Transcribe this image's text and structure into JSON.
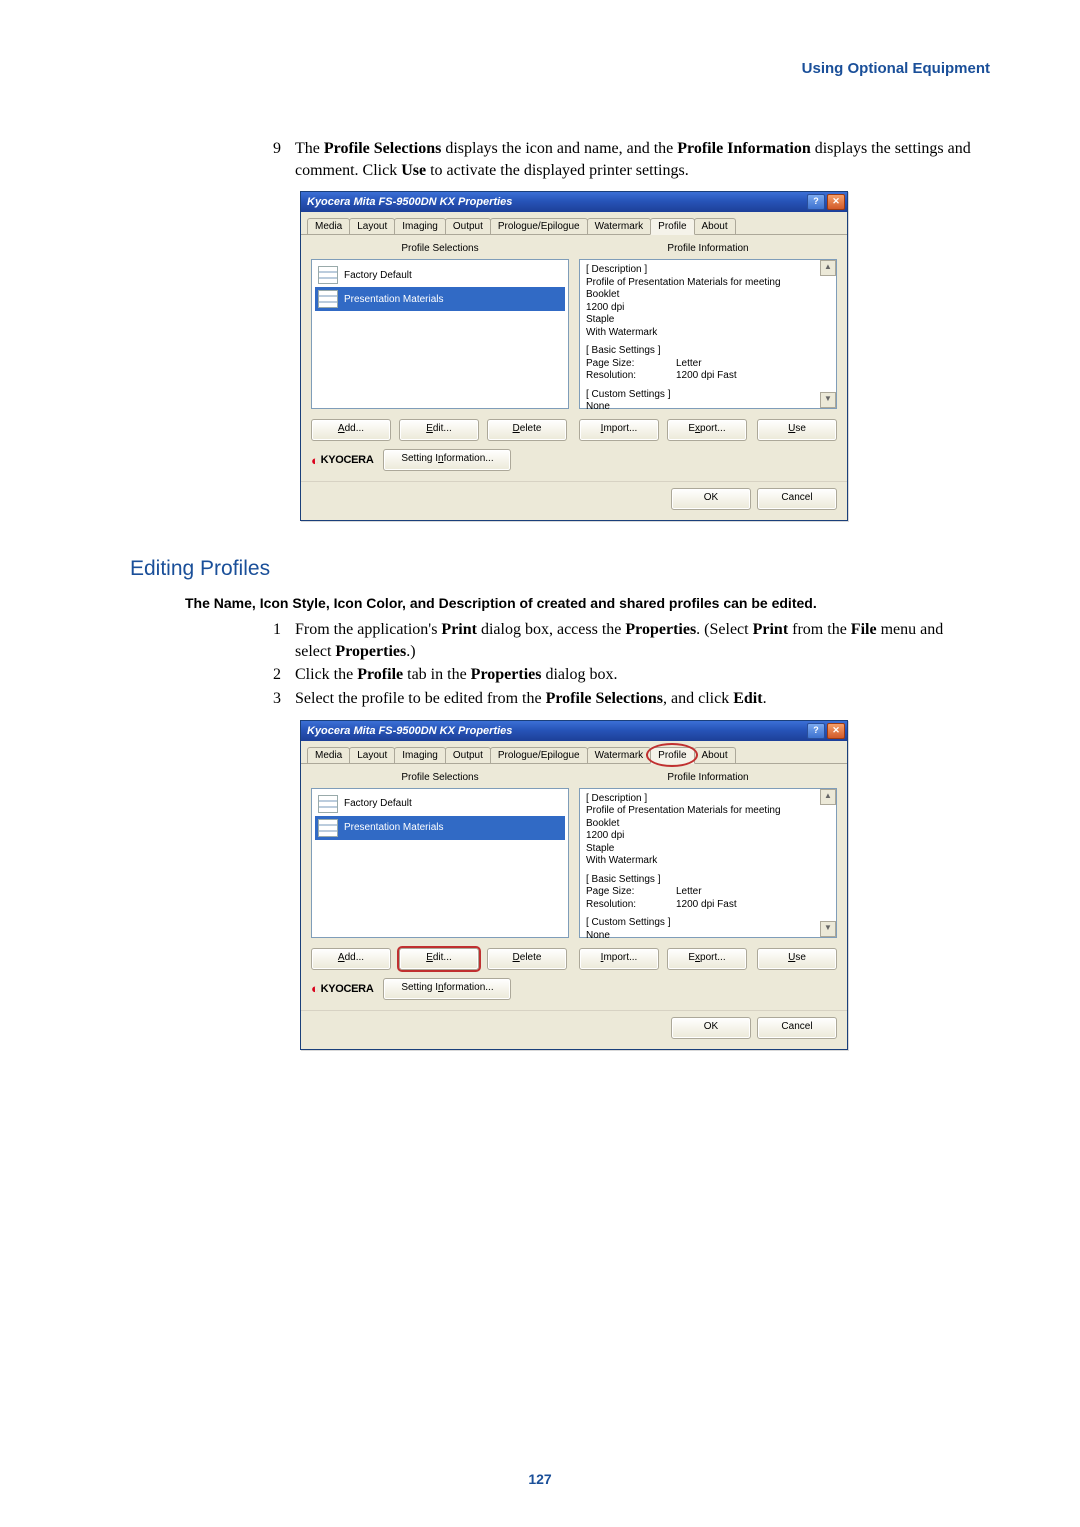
{
  "header": {
    "section": "Using Optional Equipment"
  },
  "intro_step": {
    "num": "9",
    "text_pre": "The ",
    "b1": "Profile Selections",
    "text_mid1": " displays the icon and name, and the ",
    "b2": "Profile Information",
    "text_mid2": " displays the settings and comment. Click ",
    "b3": "Use",
    "text_post": " to activate the displayed printer settings."
  },
  "dialog": {
    "title": "Kyocera Mita FS-9500DN KX Properties",
    "help_btn": "?",
    "close_btn": "✕",
    "tabs": [
      "Media",
      "Layout",
      "Imaging",
      "Output",
      "Prologue/Epilogue",
      "Watermark",
      "Profile",
      "About"
    ],
    "active_tab_index": 6,
    "left_header": "Profile Selections",
    "right_header": "Profile Information",
    "list_items": [
      "Factory Default",
      "Presentation Materials"
    ],
    "selected_index": 1,
    "info": {
      "desc_hdr": "[ Description ]",
      "desc_line": "Profile of Presentation Materials for meeting",
      "desc_details": [
        "Booklet",
        "1200 dpi",
        "Staple",
        "With Watermark"
      ],
      "basic_hdr": "[ Basic Settings ]",
      "basic_rows": [
        {
          "k": "Page Size:",
          "v": "Letter"
        },
        {
          "k": "Resolution:",
          "v": "1200 dpi Fast"
        }
      ],
      "custom_hdr": "[ Custom Settings ]",
      "custom_line": "None"
    },
    "buttons": {
      "add": "Add...",
      "edit": "Edit...",
      "delete": "Delete",
      "import": "Import...",
      "export": "Export...",
      "use": "Use",
      "setting_info": "Setting Information...",
      "ok": "OK",
      "cancel": "Cancel"
    },
    "brand": "KYOCERA"
  },
  "section_heading": "Editing Profiles",
  "bold_intro": "The Name, Icon Style, Icon Color, and Description of created and shared profiles can be edited.",
  "steps2": [
    {
      "num": "1",
      "parts": [
        "From the application's ",
        "Print",
        " dialog box, access the ",
        "Properties",
        ". (Select ",
        "Print",
        " from the ",
        "File",
        " menu and select ",
        "Properties",
        ".)"
      ]
    },
    {
      "num": "2",
      "parts": [
        "Click the ",
        "Profile",
        " tab in the ",
        "Properties",
        " dialog box."
      ]
    },
    {
      "num": "3",
      "parts": [
        "Select the profile to be edited from the ",
        "Profile Selections",
        ", and click ",
        "Edit",
        "."
      ]
    }
  ],
  "page_number": "127"
}
